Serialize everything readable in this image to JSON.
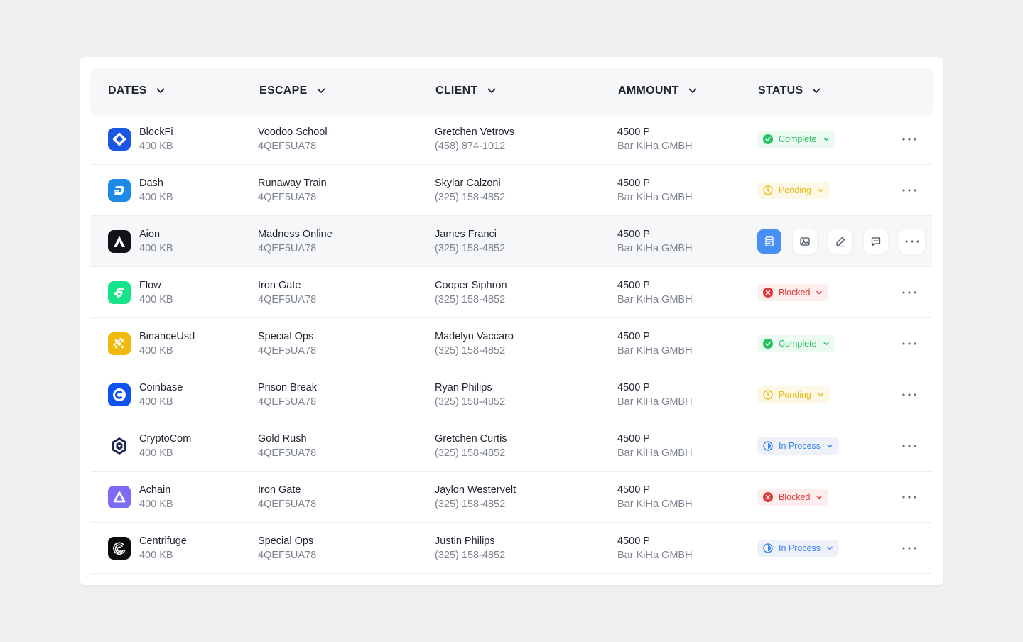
{
  "colors": {
    "complete": "#22c35e",
    "pending": "#e8bd16",
    "blocked": "#e5383b",
    "in_process": "#3b82f6",
    "accent": "#4a8ff5"
  },
  "headers": [
    "DATES",
    "ESCAPE",
    "CLIENT",
    "AMMOUNT",
    "STATUS"
  ],
  "rows": [
    {
      "coin": "BlockFi",
      "size": "400 KB",
      "escape": "Voodoo School",
      "code": "4QEF5UA78",
      "client": "Gretchen Vetrovs",
      "phone": "(458) 874-1012",
      "amount": "4500 P",
      "company": "Bar KiHa GMBH",
      "status": "Complete",
      "icon": "blockfi-icon"
    },
    {
      "coin": "Dash",
      "size": "400 KB",
      "escape": "Runaway Train",
      "code": "4QEF5UA78",
      "client": "Skylar Calzoni",
      "phone": "(325) 158-4852",
      "amount": "4500 P",
      "company": "Bar KiHa GMBH",
      "status": "Pending",
      "icon": "dash-icon"
    },
    {
      "coin": "Aion",
      "size": "400 KB",
      "escape": "Madness Online",
      "code": "4QEF5UA78",
      "client": "James Franci",
      "phone": "(325) 158-4852",
      "amount": "4500 P",
      "company": "Bar KiHa GMBH",
      "status": "",
      "icon": "aion-icon"
    },
    {
      "coin": "Flow",
      "size": "400 KB",
      "escape": "Iron Gate",
      "code": "4QEF5UA78",
      "client": "Cooper Siphron",
      "phone": "(325) 158-4852",
      "amount": "4500 P",
      "company": "Bar KiHa GMBH",
      "status": "Blocked",
      "icon": "flow-icon"
    },
    {
      "coin": "BinanceUsd",
      "size": "400 KB",
      "escape": "Special Ops",
      "code": "4QEF5UA78",
      "client": "Madelyn Vaccaro",
      "phone": "(325) 158-4852",
      "amount": "4500 P",
      "company": "Bar KiHa GMBH",
      "status": "Complete",
      "icon": "binanceusd-icon"
    },
    {
      "coin": "Coinbase",
      "size": "400 KB",
      "escape": "Prison Break",
      "code": "4QEF5UA78",
      "client": "Ryan Philips",
      "phone": "(325) 158-4852",
      "amount": "4500 P",
      "company": "Bar KiHa GMBH",
      "status": "Pending",
      "icon": "coinbase-icon"
    },
    {
      "coin": "CryptoCom",
      "size": "400 KB",
      "escape": "Gold Rush",
      "code": "4QEF5UA78",
      "client": "Gretchen Curtis",
      "phone": "(325) 158-4852",
      "amount": "4500 P",
      "company": "Bar KiHa GMBH",
      "status": "In Process",
      "icon": "cryptocom-icon"
    },
    {
      "coin": "Achain",
      "size": "400 KB",
      "escape": "Iron Gate",
      "code": "4QEF5UA78",
      "client": "Jaylon Westervelt",
      "phone": "(325) 158-4852",
      "amount": "4500 P",
      "company": "Bar KiHa GMBH",
      "status": "Blocked",
      "icon": "achain-icon"
    },
    {
      "coin": "Centrifuge",
      "size": "400 KB",
      "escape": "Special Ops",
      "code": "4QEF5UA78",
      "client": "Justin Philips",
      "phone": "(325) 158-4852",
      "amount": "4500 P",
      "company": "Bar KiHa GMBH",
      "status": "In Process",
      "icon": "centrifuge-icon"
    }
  ],
  "hover_row_actions": [
    "document-icon",
    "image-icon",
    "edit-icon",
    "comment-icon",
    "more-icon"
  ]
}
